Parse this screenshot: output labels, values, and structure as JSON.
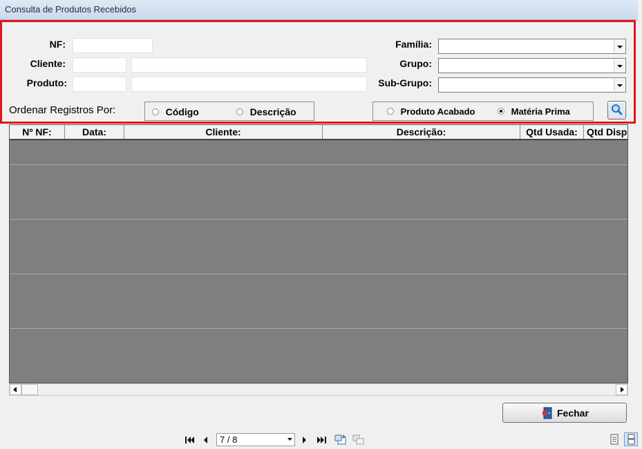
{
  "window": {
    "title": "Consulta de Produtos Recebidos"
  },
  "filters": {
    "nf_label": "NF:",
    "cliente_label": "Cliente:",
    "produto_label": "Produto:",
    "familia_label": "Família:",
    "grupo_label": "Grupo:",
    "subgrupo_label": "Sub-Grupo:",
    "nf_value": "",
    "cliente_code": "",
    "cliente_name": "",
    "produto_code": "",
    "produto_name": "",
    "familia_value": "",
    "grupo_value": "",
    "subgrupo_value": ""
  },
  "ordering": {
    "label": "Ordenar Registros Por:",
    "options": [
      "Código",
      "Descrição"
    ],
    "selected": ""
  },
  "product_type": {
    "options": [
      "Produto Acabado",
      "Matéria Prima"
    ],
    "selected": "Matéria Prima"
  },
  "grid": {
    "columns": [
      "Nº NF:",
      "Data:",
      "Cliente:",
      "Descrição:",
      "Qtd Usada:",
      "Qtd Disp"
    ],
    "rows": []
  },
  "buttons": {
    "close_label": "Fechar",
    "search_icon": "magnifier-icon"
  },
  "report_nav": {
    "page_display": "7 / 8"
  }
}
